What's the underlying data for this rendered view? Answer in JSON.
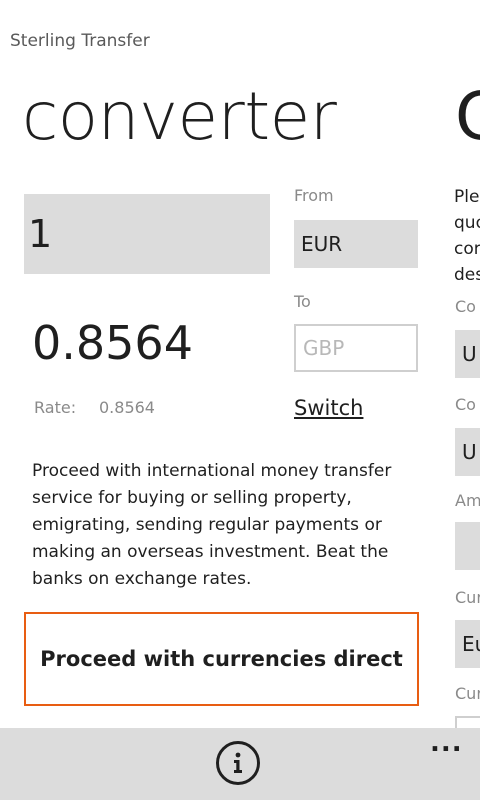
{
  "app": {
    "title": "Sterling Transfer"
  },
  "pivot": {
    "current_title": "converter",
    "next_title_peek": "C",
    "prev_title_peek": "."
  },
  "converter": {
    "amount": "1",
    "from_label": "From",
    "from_value": "EUR",
    "to_label": "To",
    "to_value": "GBP",
    "result": "0.8564",
    "rate_label": "Rate:",
    "rate_value": "0.8564",
    "switch_label": "Switch",
    "description": "Proceed with international money transfer service for buying or selling property, emigrating, sending regular payments or making an overseas investment. Beat the banks on exchange rates.",
    "proceed_label": "Proceed with currencies direct",
    "accent_color": "#e85d12"
  },
  "next_pivot_peek": {
    "text_lines": [
      "Ple",
      "quo",
      "cor",
      "des"
    ],
    "label1": "Co",
    "field1": "U",
    "label2": "Co",
    "field2": "U",
    "label3": "Am",
    "label4": "Cur",
    "field4": "Eu",
    "label5": "Cur"
  },
  "app_bar": {
    "info_icon": "info-icon",
    "more_label": "..."
  }
}
